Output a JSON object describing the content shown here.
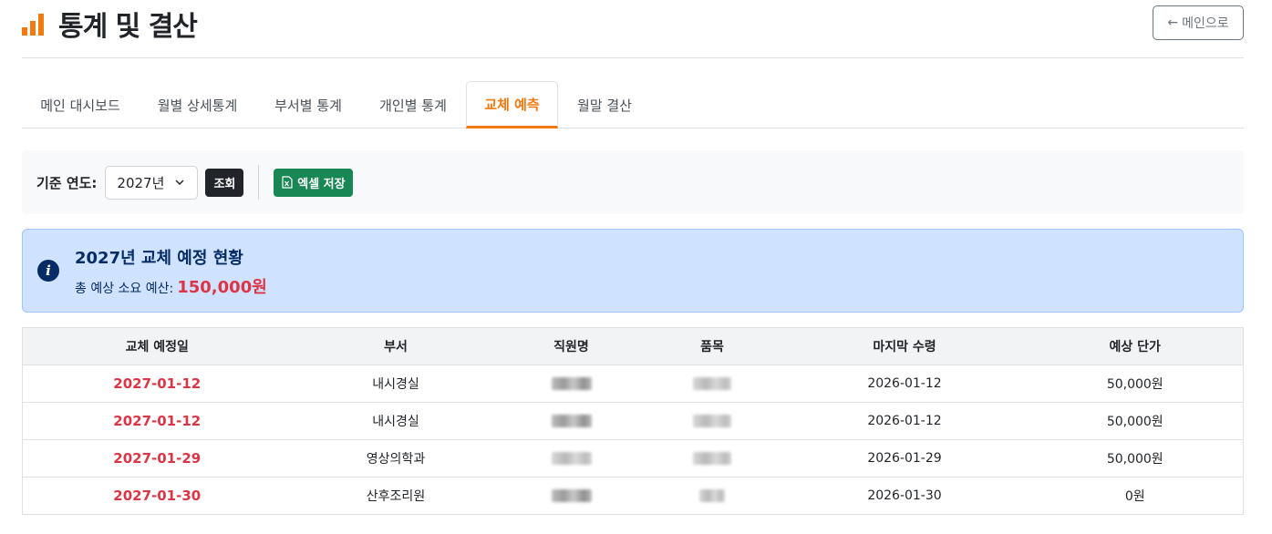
{
  "header": {
    "title": "통계 및 결산",
    "back_label": "메인으로",
    "back_arrow": "←"
  },
  "tabs": [
    {
      "label": "메인 대시보드"
    },
    {
      "label": "월별 상세통계"
    },
    {
      "label": "부서별 통계"
    },
    {
      "label": "개인별 통계"
    },
    {
      "label": "교체 예측",
      "active": true
    },
    {
      "label": "월말 결산"
    }
  ],
  "filter": {
    "label": "기준 연도:",
    "year_value": "2027년",
    "query_label": "조회",
    "excel_label": "엑셀 저장"
  },
  "alert": {
    "title": "2027년 교체 예정 현황",
    "budget_label": "총 예상 소요 예산:",
    "budget_value": "150,000원"
  },
  "table": {
    "headers": [
      "교체 예정일",
      "부서",
      "직원명",
      "품목",
      "마지막 수령",
      "예상 단가"
    ],
    "rows": [
      {
        "date": "2027-01-12",
        "dept": "내시경실",
        "last": "2026-01-12",
        "price": "50,000원"
      },
      {
        "date": "2027-01-12",
        "dept": "내시경실",
        "last": "2026-01-12",
        "price": "50,000원"
      },
      {
        "date": "2027-01-29",
        "dept": "영상의학과",
        "last": "2026-01-29",
        "price": "50,000원"
      },
      {
        "date": "2027-01-30",
        "dept": "산후조리원",
        "last": "2026-01-30",
        "price": "0원"
      }
    ]
  },
  "colors": {
    "accent": "#f07a10",
    "danger": "#dc3545",
    "success": "#198754",
    "info_bg": "#cfe2ff",
    "info_text": "#052c65"
  }
}
